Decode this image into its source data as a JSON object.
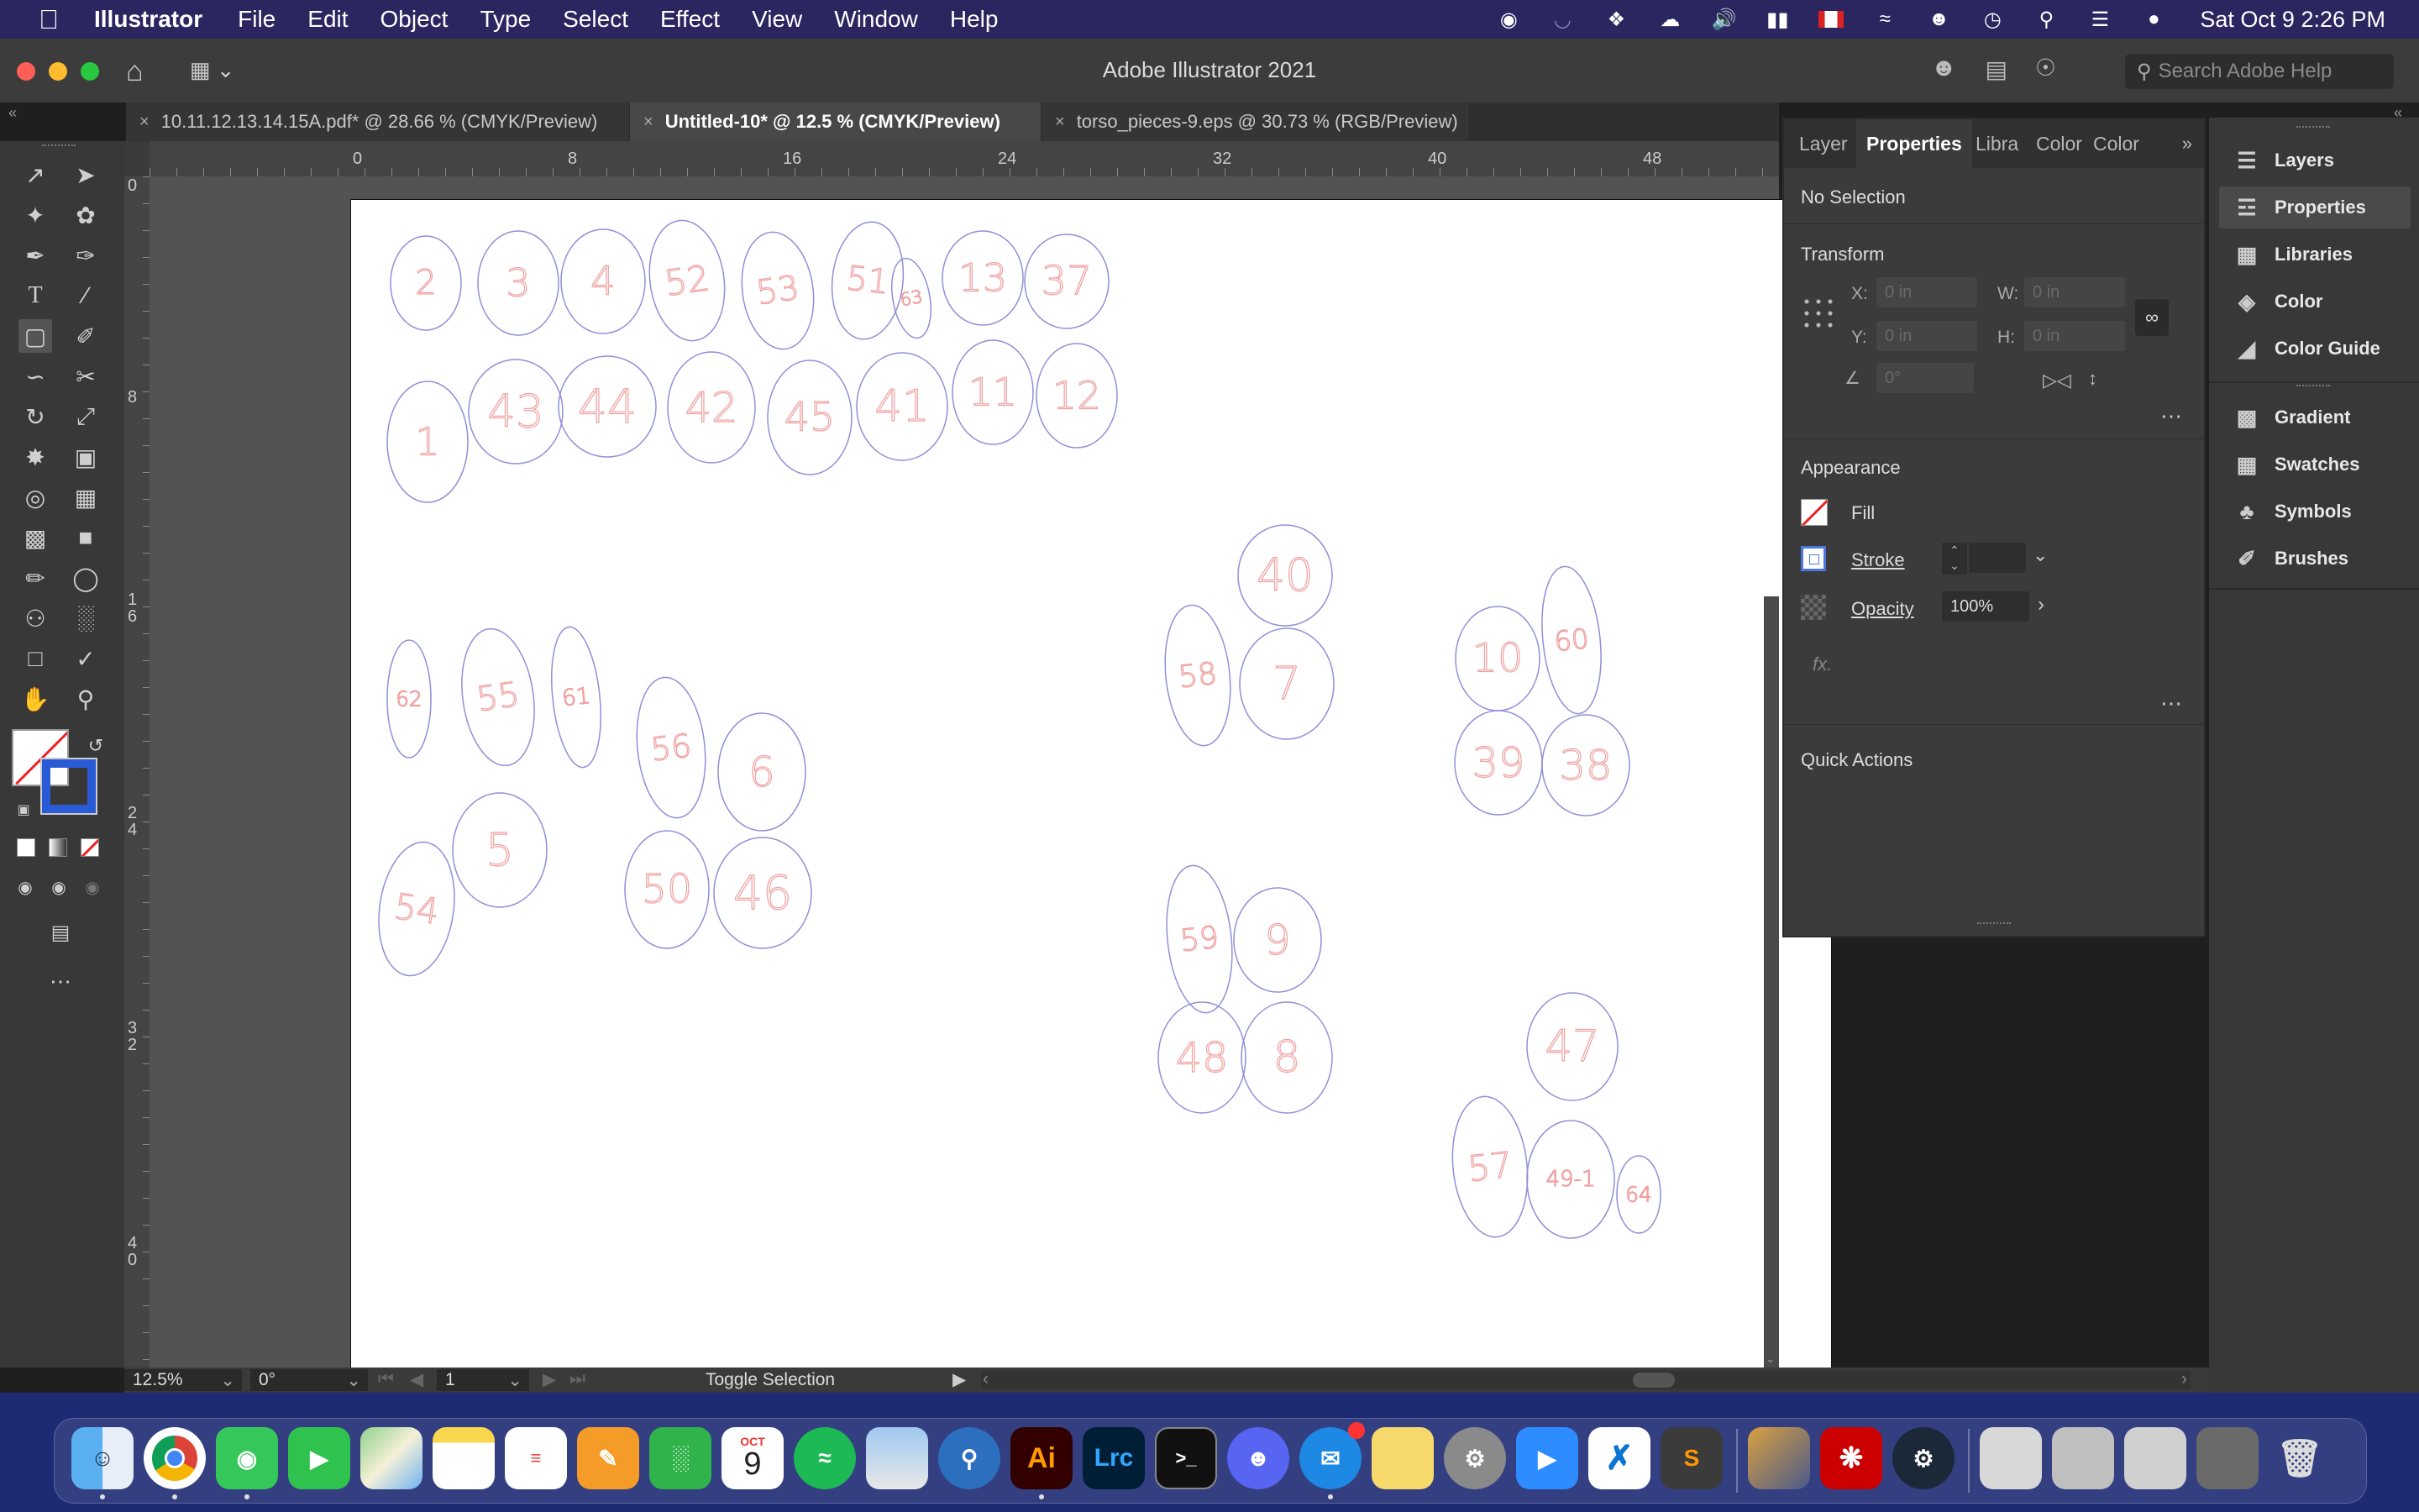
{
  "menubar": {
    "app_name": "Illustrator",
    "items": [
      "File",
      "Edit",
      "Object",
      "Type",
      "Select",
      "Effect",
      "View",
      "Window",
      "Help"
    ],
    "datetime": "Sat Oct 9  2:26 PM"
  },
  "titlebar": {
    "title": "Adobe Illustrator 2021",
    "search_placeholder": "Search Adobe Help"
  },
  "tabs": [
    {
      "label": "10.11.12.13.14.15A.pdf* @ 28.66 % (CMYK/Preview)",
      "active": false
    },
    {
      "label": "Untitled-10* @ 12.5 % (CMYK/Preview)",
      "active": true
    },
    {
      "label": "torso_pieces-9.eps @ 30.73 % (RGB/Preview)",
      "active": false
    }
  ],
  "rulers": {
    "horizontal": [
      "0",
      "8",
      "16",
      "24",
      "32",
      "40",
      "48"
    ],
    "vertical": [
      "0",
      "8",
      "1\n6",
      "2\n4",
      "3\n2",
      "4\n0"
    ]
  },
  "pieces": [
    {
      "label": "2"
    },
    {
      "label": "3"
    },
    {
      "label": "4"
    },
    {
      "label": "52"
    },
    {
      "label": "53"
    },
    {
      "label": "51"
    },
    {
      "label": "63"
    },
    {
      "label": "13"
    },
    {
      "label": "37"
    },
    {
      "label": "1"
    },
    {
      "label": "43"
    },
    {
      "label": "44"
    },
    {
      "label": "42"
    },
    {
      "label": "45"
    },
    {
      "label": "41"
    },
    {
      "label": "11"
    },
    {
      "label": "12"
    },
    {
      "label": "62"
    },
    {
      "label": "55"
    },
    {
      "label": "61"
    },
    {
      "label": "56"
    },
    {
      "label": "6"
    },
    {
      "label": "5"
    },
    {
      "label": "54"
    },
    {
      "label": "50"
    },
    {
      "label": "46"
    },
    {
      "label": "40"
    },
    {
      "label": "58"
    },
    {
      "label": "7"
    },
    {
      "label": "10"
    },
    {
      "label": "60"
    },
    {
      "label": "39"
    },
    {
      "label": "38"
    },
    {
      "label": "59"
    },
    {
      "label": "9"
    },
    {
      "label": "48"
    },
    {
      "label": "8"
    },
    {
      "label": "47"
    },
    {
      "label": "57"
    },
    {
      "label": "49-1"
    },
    {
      "label": "64"
    }
  ],
  "statusbar": {
    "zoom": "12.5%",
    "rotation": "0°",
    "artboard": "1",
    "status": "Toggle Selection"
  },
  "properties": {
    "tabs": [
      "Layer",
      "Properties",
      "Libra",
      "Color",
      "Color"
    ],
    "selection": "No Selection",
    "transform": {
      "title": "Transform",
      "x_label": "X:",
      "x_value": "0 in",
      "y_label": "Y:",
      "y_value": "0 in",
      "w_label": "W:",
      "w_value": "0 in",
      "h_label": "H:",
      "h_value": "0 in",
      "angle_value": "0°"
    },
    "appearance": {
      "title": "Appearance",
      "fill_label": "Fill",
      "stroke_label": "Stroke",
      "opacity_label": "Opacity",
      "opacity_value": "100%",
      "fx_label": "fx."
    },
    "quick_actions": "Quick Actions"
  },
  "dock": {
    "group1": [
      "Layers",
      "Properties",
      "Libraries",
      "Color",
      "Color Guide"
    ],
    "group2": [
      "Gradient",
      "Swatches",
      "Symbols",
      "Brushes"
    ]
  },
  "tools_fill": {
    "fill": "none",
    "stroke": "#2a5bd7"
  },
  "colors": {
    "menubar": "#2b2560",
    "piece_outline": "#8f90d8",
    "piece_label": "#f0a0a0"
  },
  "mac_dock": {
    "apps": [
      "Finder",
      "Chrome",
      "Messages",
      "FaceTime",
      "Maps",
      "Notes",
      "Reminders",
      "Pages",
      "Numbers",
      "Calendar",
      "Spotify",
      "Preview",
      "QuickTime",
      "Illustrator",
      "Lightroom Classic",
      "Terminal",
      "Discord",
      "Mail",
      "Stickies",
      "System Preferences",
      "Zoom",
      "VS Code",
      "Sublime Text",
      "Migration",
      "Acrobat",
      "Steam",
      "Files",
      "Folder 1",
      "Folder 2",
      "Folder 3",
      "Trash"
    ],
    "calendar_month": "OCT",
    "calendar_day": "9",
    "ai_label": "Ai",
    "lrc_label": "Lrc"
  }
}
